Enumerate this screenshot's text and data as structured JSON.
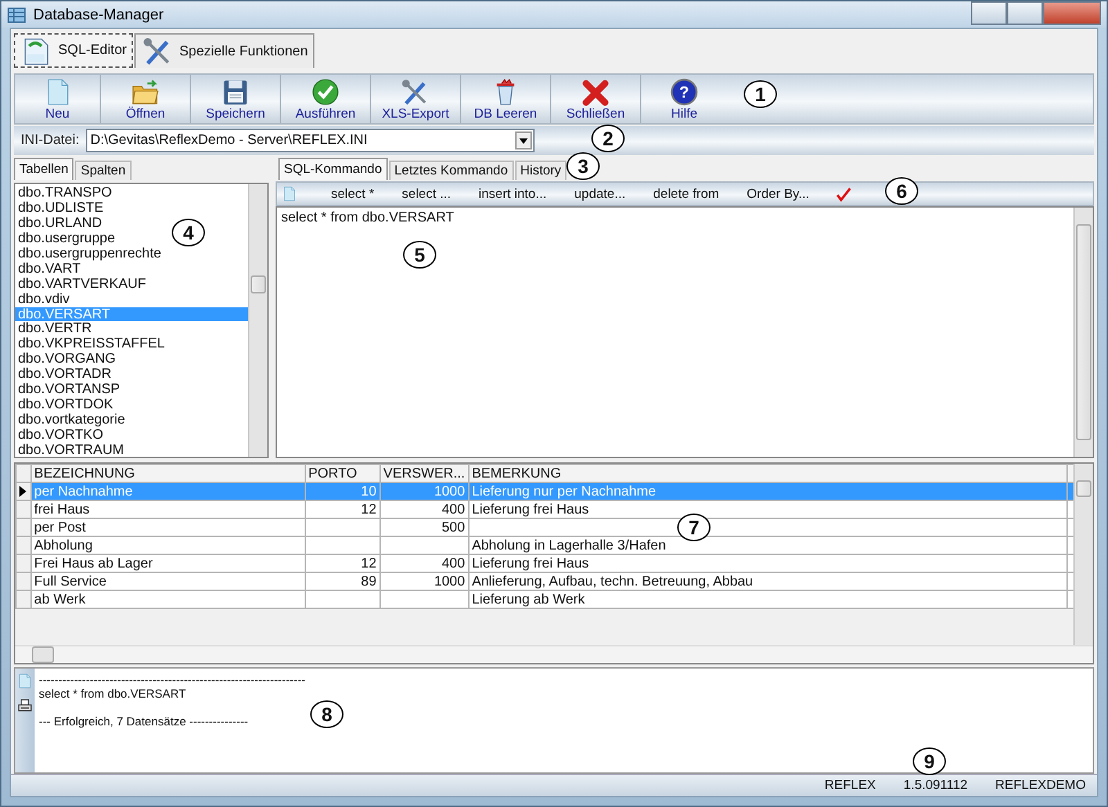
{
  "window": {
    "title": "Database-Manager"
  },
  "main_tabs": [
    {
      "label": "SQL-Editor",
      "kind": "editor",
      "selected": true
    },
    {
      "label": "Spezielle Funktionen",
      "kind": "tools",
      "selected": false
    }
  ],
  "toolbar": [
    {
      "label": "Neu",
      "kind": "doc"
    },
    {
      "label": "Öffnen",
      "kind": "folder"
    },
    {
      "label": "Speichern",
      "kind": "floppy"
    },
    {
      "label": "Ausführen",
      "kind": "check"
    },
    {
      "label": "XLS-Export",
      "kind": "tools"
    },
    {
      "label": "DB Leeren",
      "kind": "trash"
    },
    {
      "label": "Schließen",
      "kind": "cross"
    },
    {
      "label": "Hilfe",
      "kind": "help",
      "glyph": "?"
    }
  ],
  "ini": {
    "label": "INI-Datei:",
    "value": "D:\\Gevitas\\ReflexDemo - Server\\REFLEX.INI"
  },
  "left_tabs": [
    {
      "label": "Tabellen",
      "selected": true
    },
    {
      "label": "Spalten",
      "selected": false
    }
  ],
  "tables": [
    {
      "name": "dbo.TRANSPO",
      "selected": false
    },
    {
      "name": "dbo.UDLISTE",
      "selected": false
    },
    {
      "name": "dbo.URLAND",
      "selected": false
    },
    {
      "name": "dbo.usergruppe",
      "selected": false
    },
    {
      "name": "dbo.usergruppenrechte",
      "selected": false
    },
    {
      "name": "dbo.VART",
      "selected": false
    },
    {
      "name": "dbo.VARTVERKAUF",
      "selected": false
    },
    {
      "name": "dbo.vdiv",
      "selected": false
    },
    {
      "name": "dbo.VERSART",
      "selected": true
    },
    {
      "name": "dbo.VERTR",
      "selected": false
    },
    {
      "name": "dbo.VKPREISSTAFFEL",
      "selected": false
    },
    {
      "name": "dbo.VORGANG",
      "selected": false
    },
    {
      "name": "dbo.VORTADR",
      "selected": false
    },
    {
      "name": "dbo.VORTANSP",
      "selected": false
    },
    {
      "name": "dbo.VORTDOK",
      "selected": false
    },
    {
      "name": "dbo.vortkategorie",
      "selected": false
    },
    {
      "name": "dbo.VORTKO",
      "selected": false
    },
    {
      "name": "dbo.VORTRAUM",
      "selected": false
    }
  ],
  "right_tabs": [
    {
      "label": "SQL-Kommando",
      "selected": true
    },
    {
      "label": "Letztes Kommando",
      "selected": false
    },
    {
      "label": "History",
      "selected": false
    }
  ],
  "sql_toolbar": [
    {
      "kind": "icon"
    },
    {
      "kind": "text",
      "label": "select *"
    },
    {
      "kind": "text",
      "label": "select ..."
    },
    {
      "kind": "text",
      "label": "insert into..."
    },
    {
      "kind": "text",
      "label": "update..."
    },
    {
      "kind": "text",
      "label": "delete from"
    },
    {
      "kind": "text",
      "label": "Order By..."
    },
    {
      "kind": "check"
    }
  ],
  "sql_text": "select * from dbo.VERSART",
  "grid": {
    "columns": [
      "BEZEICHNUNG",
      "PORTO",
      "VERSWER...",
      "BEMERKUNG"
    ],
    "rows": [
      {
        "cells": [
          "per Nachnahme",
          "10",
          "1000",
          "Lieferung nur per Nachnahme"
        ],
        "selected": true
      },
      {
        "cells": [
          "frei Haus",
          "12",
          "400",
          "Lieferung frei Haus"
        ],
        "selected": false
      },
      {
        "cells": [
          "per Post",
          "",
          "500",
          ""
        ],
        "selected": false
      },
      {
        "cells": [
          "Abholung",
          "",
          "",
          "Abholung in Lagerhalle 3/Hafen"
        ],
        "selected": false
      },
      {
        "cells": [
          "Frei Haus ab Lager",
          "12",
          "400",
          "Lieferung frei Haus"
        ],
        "selected": false
      },
      {
        "cells": [
          "Full Service",
          "89",
          "1000",
          "Anlieferung, Aufbau, techn. Betreuung, Abbau"
        ],
        "selected": false
      },
      {
        "cells": [
          "ab Werk",
          "",
          "",
          "Lieferung ab Werk"
        ],
        "selected": false
      }
    ]
  },
  "log": [
    "--------------------------------------------------------------------",
    "select * from dbo.VERSART",
    "--- Erfolgreich, 7 Datensätze ---------------"
  ],
  "status_bar": [
    "REFLEX",
    "1.5.091112",
    "REFLEXDEMO"
  ],
  "callouts": [
    "1",
    "2",
    "3",
    "4",
    "5",
    "6",
    "7",
    "8",
    "9"
  ]
}
